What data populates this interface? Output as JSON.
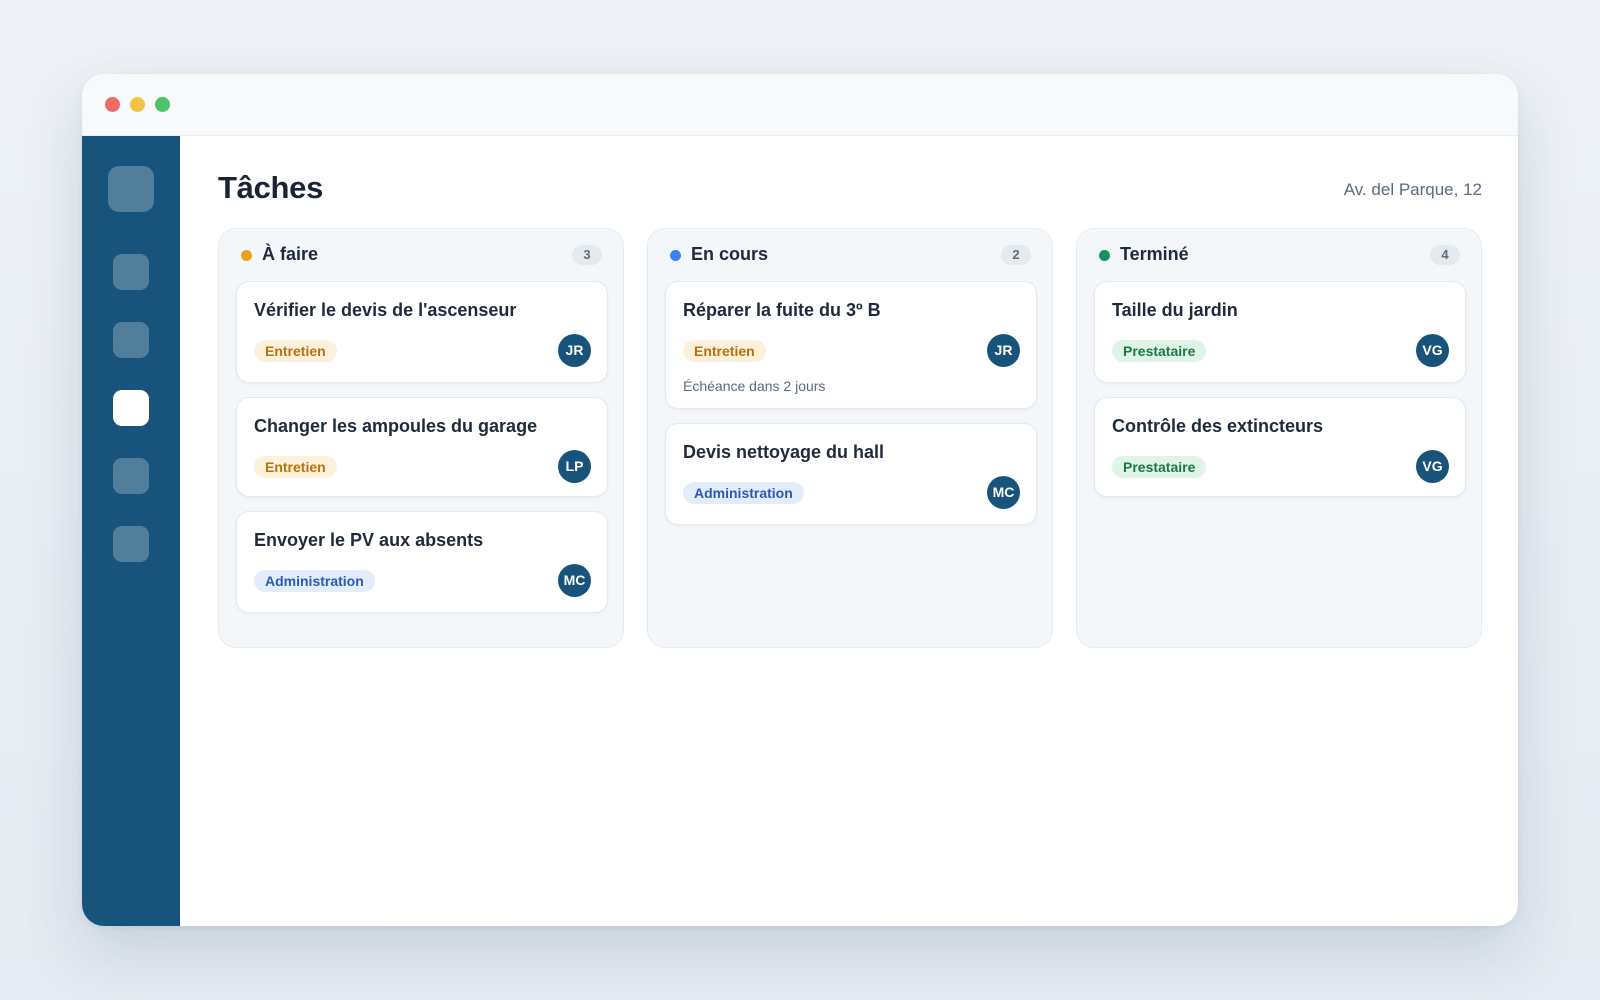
{
  "page": {
    "title": "Tâches",
    "address": "Av. del Parque, 12"
  },
  "colors": {
    "sidebar": "#17537a",
    "todo": "#eba11c",
    "in_progress": "#3d82f0",
    "done": "#14935a"
  },
  "sidebar": {
    "items": [
      {
        "icon": "home-icon",
        "active": false
      },
      {
        "icon": "building-icon",
        "active": false
      },
      {
        "icon": "tasks-icon",
        "active": true
      },
      {
        "icon": "documents-icon",
        "active": false
      },
      {
        "icon": "settings-icon",
        "active": false
      }
    ]
  },
  "columns": [
    {
      "title": "À faire",
      "count": "3",
      "cards": [
        {
          "title": "Vérifier le devis de l'ascenseur",
          "tag": "Entretien",
          "assignee": "JR"
        },
        {
          "title": "Changer les ampoules du garage",
          "tag": "Entretien",
          "assignee": "LP"
        },
        {
          "title": "Envoyer le PV aux absents",
          "tag": "Administration",
          "assignee": "MC"
        }
      ]
    },
    {
      "title": "En cours",
      "count": "2",
      "cards": [
        {
          "title": "Réparer la fuite du 3º B",
          "tag": "Entretien",
          "assignee": "JR",
          "due": "Échéance dans 2 jours"
        },
        {
          "title": "Devis nettoyage du hall",
          "tag": "Administration",
          "assignee": "MC"
        }
      ]
    },
    {
      "title": "Terminé",
      "count": "4",
      "cards": [
        {
          "title": "Taille du jardin",
          "tag": "Prestataire",
          "assignee": "VG"
        },
        {
          "title": "Contrôle des extincteurs",
          "tag": "Prestataire",
          "assignee": "VG"
        }
      ]
    }
  ]
}
